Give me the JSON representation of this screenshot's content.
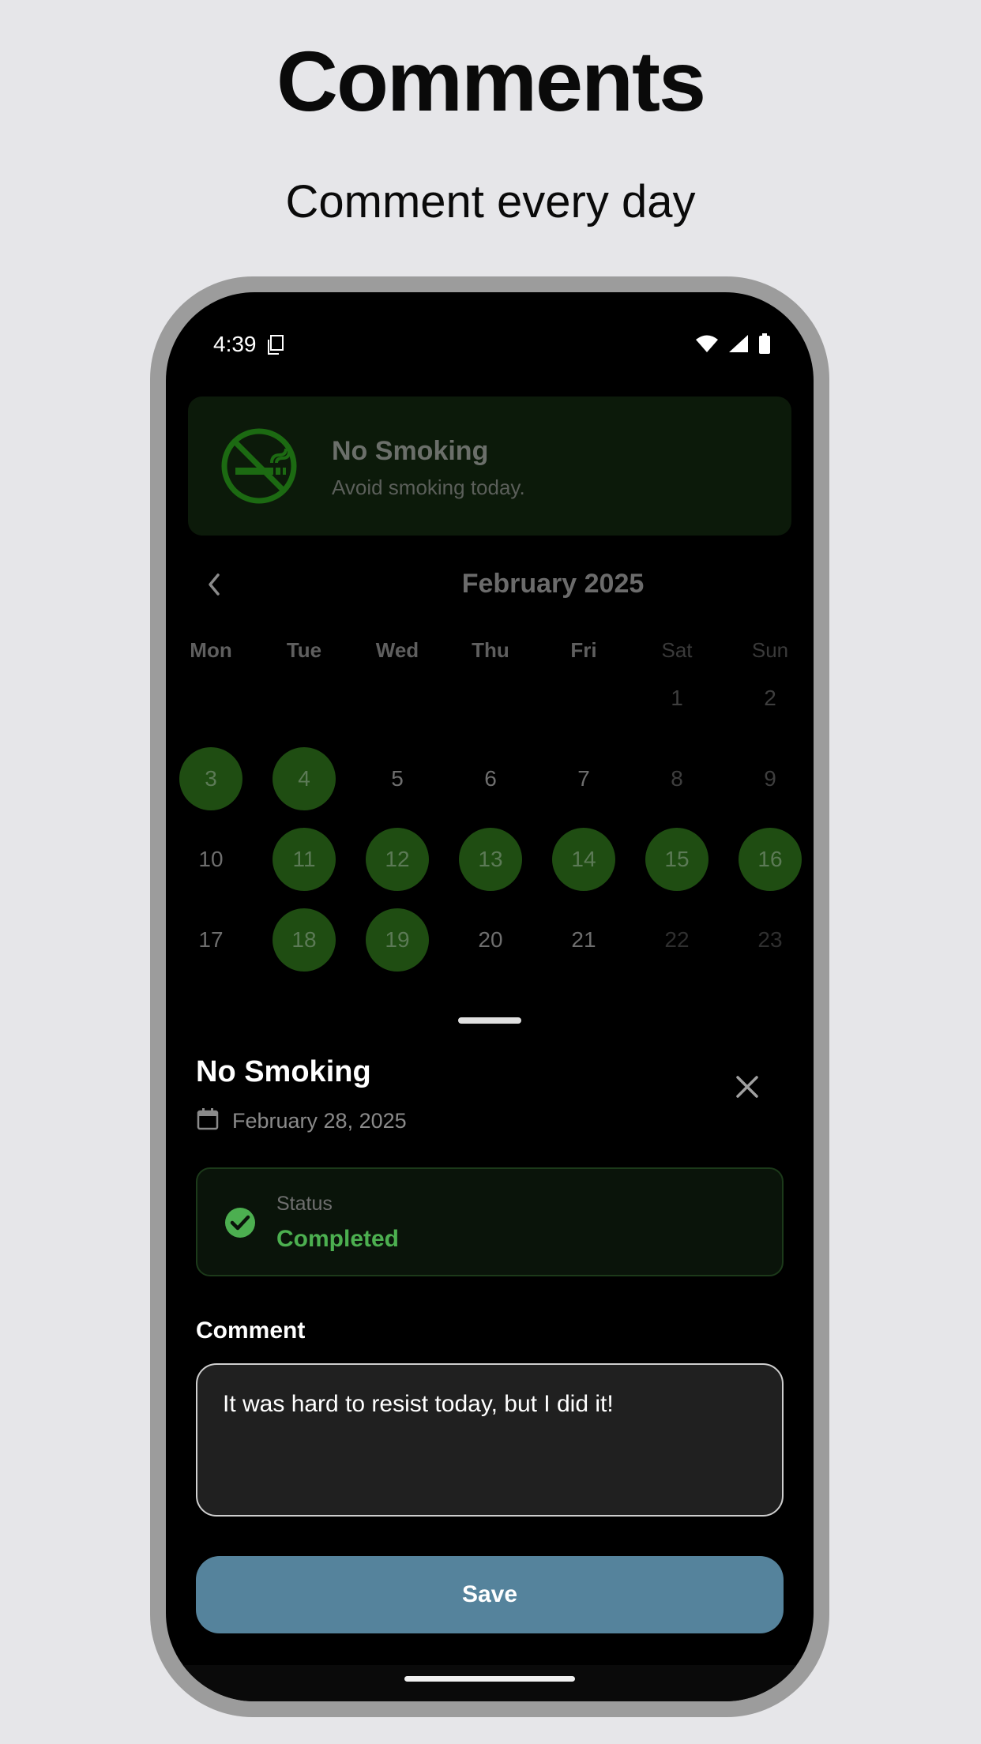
{
  "promo": {
    "title": "Comments",
    "subtitle": "Comment every day"
  },
  "status_bar": {
    "time": "4:39"
  },
  "habit": {
    "title": "No Smoking",
    "description": "Avoid smoking today.",
    "icon": "no-smoking-icon"
  },
  "calendar": {
    "month_label": "February 2025",
    "weekdays": [
      "Mon",
      "Tue",
      "Wed",
      "Thu",
      "Fri",
      "Sat",
      "Sun"
    ],
    "weeks": [
      [
        null,
        null,
        null,
        null,
        null,
        {
          "d": "1",
          "s": "weekend"
        },
        {
          "d": "2",
          "s": "weekend"
        }
      ],
      [
        {
          "d": "3",
          "s": "done"
        },
        {
          "d": "4",
          "s": "done"
        },
        {
          "d": "5",
          "s": "none"
        },
        {
          "d": "6",
          "s": "none"
        },
        {
          "d": "7",
          "s": "none"
        },
        {
          "d": "8",
          "s": "weekend"
        },
        {
          "d": "9",
          "s": "weekend"
        }
      ],
      [
        {
          "d": "10",
          "s": "none"
        },
        {
          "d": "11",
          "s": "done"
        },
        {
          "d": "12",
          "s": "done"
        },
        {
          "d": "13",
          "s": "done"
        },
        {
          "d": "14",
          "s": "done"
        },
        {
          "d": "15",
          "s": "done"
        },
        {
          "d": "16",
          "s": "done"
        }
      ],
      [
        {
          "d": "17",
          "s": "none"
        },
        {
          "d": "18",
          "s": "done"
        },
        {
          "d": "19",
          "s": "done"
        },
        {
          "d": "20",
          "s": "none"
        },
        {
          "d": "21",
          "s": "none"
        },
        {
          "d": "22",
          "s": "future"
        },
        {
          "d": "23",
          "s": "future"
        }
      ]
    ]
  },
  "sheet": {
    "title": "No Smoking",
    "date": "February 28, 2025",
    "status_label": "Status",
    "status_value": "Completed",
    "comment_label": "Comment",
    "comment_value": "It was hard to resist today, but I did it!",
    "save_label": "Save"
  },
  "colors": {
    "completed": "#4caf50",
    "done_day_bg": "#1f4d12",
    "save_button": "#55839c"
  }
}
